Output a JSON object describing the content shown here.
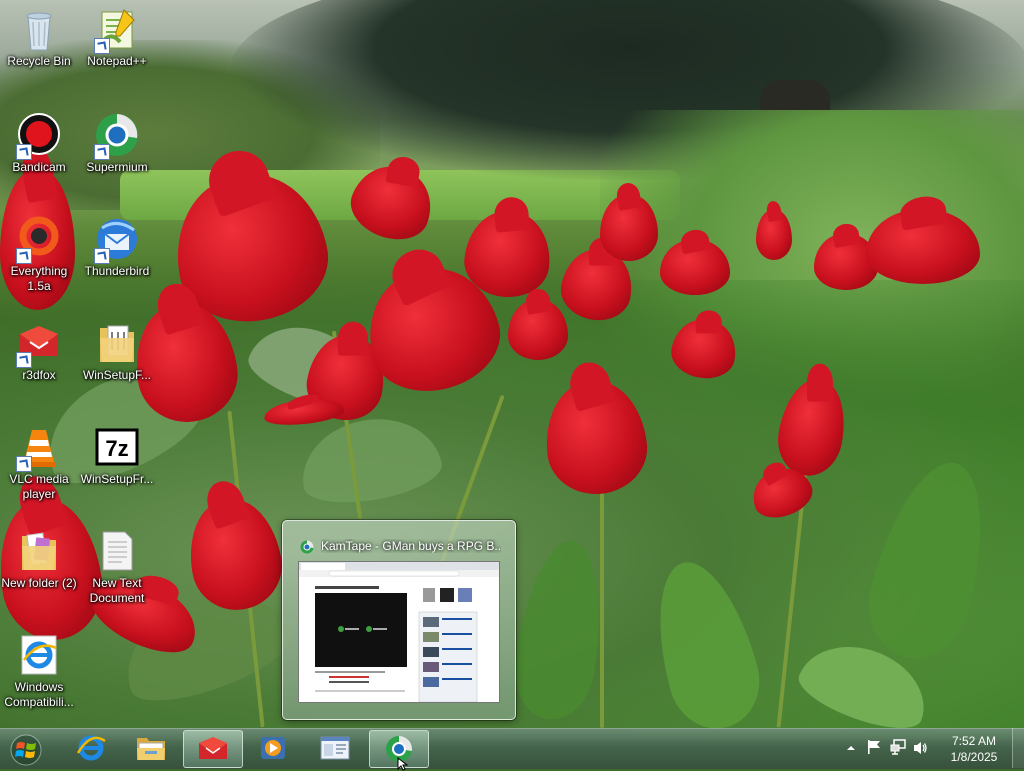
{
  "desktop": {
    "icons": [
      {
        "label": "Recycle Bin",
        "icon": "recycle-bin-icon",
        "shortcut": false
      },
      {
        "label": "Notepad++",
        "icon": "notepad-plus-plus-icon",
        "shortcut": true
      },
      {
        "label": "Bandicam",
        "icon": "bandicam-icon",
        "shortcut": true
      },
      {
        "label": "Supermium",
        "icon": "supermium-icon",
        "shortcut": true
      },
      {
        "label": "Everything 1.5a",
        "icon": "everything-icon",
        "shortcut": true
      },
      {
        "label": "Thunderbird",
        "icon": "thunderbird-icon",
        "shortcut": true
      },
      {
        "label": "r3dfox",
        "icon": "r3dfox-icon",
        "shortcut": true
      },
      {
        "label": "WinSetupF...",
        "icon": "folder-icon",
        "shortcut": false
      },
      {
        "label": "VLC media player",
        "icon": "vlc-icon",
        "shortcut": true
      },
      {
        "label": "WinSetupFr...",
        "icon": "7zip-archive-icon",
        "shortcut": false
      },
      {
        "label": "New folder (2)",
        "icon": "folder-icon",
        "shortcut": false
      },
      {
        "label": "New Text Document",
        "icon": "text-document-icon",
        "shortcut": false
      },
      {
        "label": "Windows Compatibili...",
        "icon": "internet-explorer-icon",
        "shortcut": false
      }
    ]
  },
  "taskbar": {
    "start_icon": "windows-start-icon",
    "pinned": [
      {
        "icon": "internet-explorer-icon",
        "active": false
      },
      {
        "icon": "file-explorer-icon",
        "active": false
      },
      {
        "icon": "r3dfox-icon",
        "active": true
      },
      {
        "icon": "media-player-icon",
        "active": false
      },
      {
        "icon": "control-panel-icon",
        "active": false
      },
      {
        "icon": "supermium-icon",
        "active": true
      }
    ],
    "tray": {
      "icons": [
        "show-hidden-icons-icon",
        "action-center-flag-icon",
        "network-icon",
        "volume-icon"
      ]
    },
    "clock": {
      "time": "7:52 AM",
      "date": "1/8/2025"
    }
  },
  "thumbnail": {
    "title": "KamTape - GMan buys a RPG B...",
    "icon": "supermium-icon"
  },
  "colors": {
    "tulip_red": "#c8101e",
    "taskbar_glass": "#4a6e56",
    "supermium_blue": "#1f6fc0"
  }
}
